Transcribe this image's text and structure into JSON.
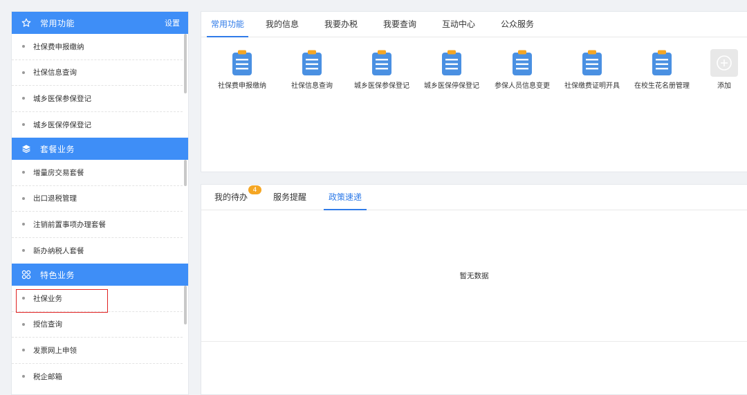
{
  "sidebar": {
    "sections": [
      {
        "title": "常用功能",
        "icon": "star-icon",
        "action": "设置",
        "items": [
          "社保费申报缴纳",
          "社保信息查询",
          "城乡医保参保登记",
          "城乡医保停保登记"
        ]
      },
      {
        "title": "套餐业务",
        "icon": "layers-icon",
        "items": [
          "增量房交易套餐",
          "出口退税管理",
          "注销前置事项办理套餐",
          "新办纳税人套餐"
        ]
      },
      {
        "title": "特色业务",
        "icon": "grid-icon",
        "items": [
          "社保业务",
          "授信查询",
          "发票网上申领",
          "税企邮箱"
        ]
      }
    ]
  },
  "top_panel": {
    "tabs": [
      "常用功能",
      "我的信息",
      "我要办税",
      "我要查询",
      "互动中心",
      "公众服务"
    ],
    "active_tab": 0,
    "functions": [
      {
        "label": "社保费申报缴纳",
        "icon": "clipboard-icon"
      },
      {
        "label": "社保信息查询",
        "icon": "clipboard-icon"
      },
      {
        "label": "城乡医保参保登记",
        "icon": "clipboard-icon"
      },
      {
        "label": "城乡医保停保登记",
        "icon": "clipboard-icon"
      },
      {
        "label": "参保人员信息变更",
        "icon": "clipboard-icon"
      },
      {
        "label": "社保缴费证明开具",
        "icon": "clipboard-icon"
      },
      {
        "label": "在校生花名册管理",
        "icon": "clipboard-icon"
      },
      {
        "label": "添加",
        "icon": "plus-circle-icon"
      }
    ]
  },
  "bottom_panel": {
    "tabs": [
      "我的待办",
      "服务提醒",
      "政策速递"
    ],
    "badge": "4",
    "active_tab": 2,
    "empty_text": "暂无数据"
  },
  "colors": {
    "accent": "#3e8ef7",
    "tab_active": "#2f7be8",
    "badge": "#f5a623",
    "icon_body": "#4a90e2",
    "icon_clip": "#f5a623",
    "highlight_border": "#e02020"
  }
}
